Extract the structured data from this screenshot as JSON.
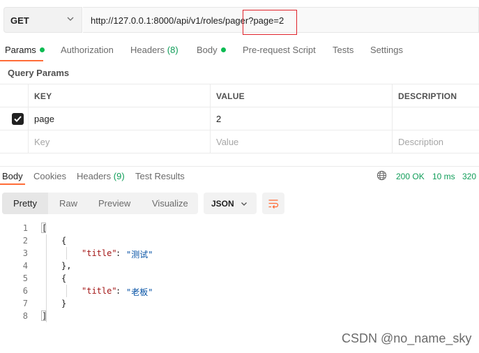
{
  "url_bar": {
    "method": "GET",
    "url": "http://127.0.0.1:8000/api/v1/roles/pager?page=2"
  },
  "request_tabs": [
    {
      "label": "Params",
      "active": true,
      "dot": true
    },
    {
      "label": "Authorization",
      "active": false
    },
    {
      "label": "Headers",
      "count": "(8)",
      "active": false
    },
    {
      "label": "Body",
      "active": false,
      "dot": true
    },
    {
      "label": "Pre-request Script",
      "active": false
    },
    {
      "label": "Tests",
      "active": false
    },
    {
      "label": "Settings",
      "active": false
    }
  ],
  "query_params": {
    "title": "Query Params",
    "columns": [
      "KEY",
      "VALUE",
      "DESCRIPTION"
    ],
    "rows": [
      {
        "checked": true,
        "key": "page",
        "value": "2",
        "description": ""
      }
    ],
    "placeholders": {
      "key": "Key",
      "value": "Value",
      "description": "Description"
    }
  },
  "response_tabs": [
    {
      "label": "Body",
      "active": true
    },
    {
      "label": "Cookies",
      "active": false
    },
    {
      "label": "Headers",
      "count": "(9)",
      "active": false
    },
    {
      "label": "Test Results",
      "active": false
    }
  ],
  "response_status": {
    "status": "200 OK",
    "time": "10 ms",
    "size": "320"
  },
  "view_modes": [
    "Pretty",
    "Raw",
    "Preview",
    "Visualize"
  ],
  "format_select": "JSON",
  "code_lines": [
    "1",
    "2",
    "3",
    "4",
    "5",
    "6",
    "7",
    "8"
  ],
  "json_body": {
    "open": "[",
    "close": "]",
    "obj_open": "{",
    "obj_close": "}",
    "obj_close_comma": "},",
    "key": "\"title\"",
    "colon": ": ",
    "value_1": "\"测试\"",
    "value_2": "\"老板\""
  },
  "watermark": "CSDN @no_name_sky",
  "colors": {
    "accent": "#ff6c37",
    "success": "#0f9d58",
    "dot": "#0cbb52",
    "highlight_box": "#e0222a"
  }
}
